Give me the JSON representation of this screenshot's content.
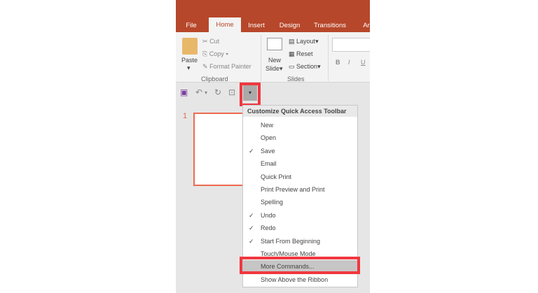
{
  "tabs": [
    "File",
    "Home",
    "Insert",
    "Design",
    "Transitions",
    "An"
  ],
  "clipboard": {
    "paste": "Paste",
    "cut": "Cut",
    "copy": "Copy",
    "format_painter": "Format Painter",
    "group": "Clipboard"
  },
  "slides": {
    "new_slide_1": "New",
    "new_slide_2": "Slide",
    "layout": "Layout",
    "reset": "Reset",
    "section": "Section",
    "group": "Slides"
  },
  "font": {
    "bold": "B",
    "italic": "I",
    "underline": "U"
  },
  "thumbnail_number": "1",
  "menu": {
    "title": "Customize Quick Access Toolbar",
    "items": [
      {
        "label": "New",
        "checked": false
      },
      {
        "label": "Open",
        "checked": false
      },
      {
        "label": "Save",
        "checked": true
      },
      {
        "label": "Email",
        "checked": false
      },
      {
        "label": "Quick Print",
        "checked": false
      },
      {
        "label": "Print Preview and Print",
        "checked": false
      },
      {
        "label": "Spelling",
        "checked": false
      },
      {
        "label": "Undo",
        "checked": true
      },
      {
        "label": "Redo",
        "checked": true
      },
      {
        "label": "Start From Beginning",
        "checked": true
      },
      {
        "label": "Touch/Mouse Mode",
        "checked": false
      },
      {
        "label": "More Commands...",
        "checked": false,
        "highlighted": true
      },
      {
        "label": "Show Above the Ribbon",
        "checked": false
      }
    ]
  },
  "colors": {
    "accent": "#b7472a",
    "highlight_box": "#f0373f"
  }
}
